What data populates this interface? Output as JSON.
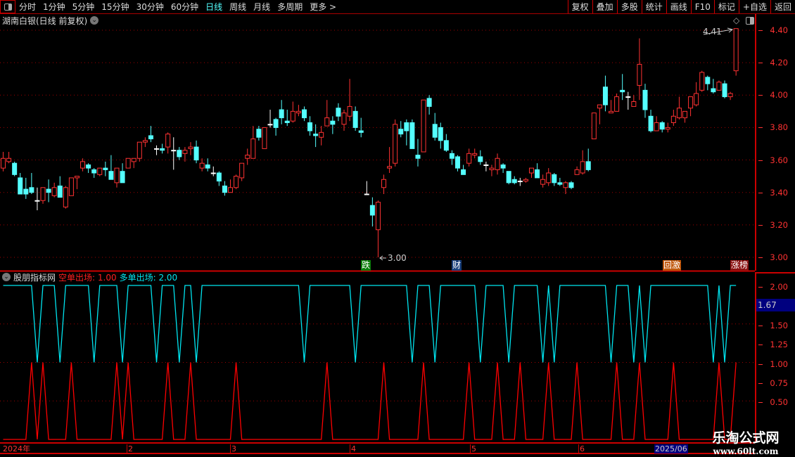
{
  "toolbar": {
    "periods": [
      "分时",
      "1分钟",
      "5分钟",
      "15分钟",
      "30分钟",
      "60分钟",
      "日线",
      "周线",
      "月线",
      "多周期",
      "更多 >"
    ],
    "active_period": "日线",
    "buttons": [
      "复权",
      "叠加",
      "多股",
      "统计",
      "画线",
      "F10",
      "标记",
      "+自选",
      "返回"
    ]
  },
  "title": "湖南白银(日线 前复权)",
  "indicator": {
    "name": "股朋指标网",
    "short_exit_label": "空单出场: 1.00",
    "long_exit_label": "多单出场: 2.00"
  },
  "price_axis": [
    "4.40",
    "4.20",
    "4.00",
    "3.80",
    "3.60",
    "3.40",
    "3.20",
    "3.00"
  ],
  "indicator_axis": [
    "2.00",
    "1.50",
    "1.25",
    "1.00",
    "0.75",
    "0.50"
  ],
  "indicator_cursor_value": "1.67",
  "annotations": {
    "high": "4.41",
    "low": "3.00"
  },
  "event_tags": [
    {
      "text": "跌",
      "color": "#0a7d0a"
    },
    {
      "text": "财",
      "color": "#1a3f7a"
    },
    {
      "text": "回激",
      "color": "#c0560a"
    },
    {
      "text": "涨榜",
      "color": "#8a1010"
    }
  ],
  "date_axis": [
    "2024年",
    "2",
    "3",
    "4",
    "5",
    "6"
  ],
  "date_cursor": "2025/06",
  "logo": {
    "line1": "乐淘公式网",
    "line2": "www.60lt.com"
  },
  "colors": {
    "up": "#ff3232",
    "down": "#54ffff",
    "doji": "#ffffff",
    "grid": "#a00000",
    "short_exit": "#ff0000",
    "long_exit": "#00e5f0"
  },
  "chart_data": [
    {
      "type": "candlestick",
      "ylim": [
        3.0,
        4.4
      ],
      "ohlc": [
        [
          3.55,
          3.65,
          3.53,
          3.61
        ],
        [
          3.59,
          3.65,
          3.58,
          3.61
        ],
        [
          3.58,
          3.59,
          3.5,
          3.51
        ],
        [
          3.49,
          3.52,
          3.39,
          3.39
        ],
        [
          3.42,
          3.49,
          3.36,
          3.39
        ],
        [
          3.43,
          3.52,
          3.39,
          3.4
        ],
        [
          3.35,
          3.43,
          3.29,
          3.35
        ],
        [
          3.35,
          3.43,
          3.33,
          3.43
        ],
        [
          3.42,
          3.48,
          3.34,
          3.4
        ],
        [
          3.38,
          3.46,
          3.37,
          3.43
        ],
        [
          3.44,
          3.5,
          3.37,
          3.37
        ],
        [
          3.31,
          3.44,
          3.3,
          3.43
        ],
        [
          3.38,
          3.49,
          3.38,
          3.49
        ],
        [
          3.49,
          3.5,
          3.42,
          3.5
        ],
        [
          3.55,
          3.61,
          3.53,
          3.59
        ],
        [
          3.57,
          3.58,
          3.52,
          3.55
        ],
        [
          3.54,
          3.55,
          3.49,
          3.52
        ],
        [
          3.51,
          3.55,
          3.5,
          3.55
        ],
        [
          3.55,
          3.59,
          3.5,
          3.54
        ],
        [
          3.53,
          3.63,
          3.48,
          3.48
        ],
        [
          3.46,
          3.55,
          3.43,
          3.55
        ],
        [
          3.53,
          3.58,
          3.46,
          3.46
        ],
        [
          3.55,
          3.61,
          3.55,
          3.61
        ],
        [
          3.59,
          3.61,
          3.55,
          3.61
        ],
        [
          3.61,
          3.71,
          3.59,
          3.71
        ],
        [
          3.71,
          3.74,
          3.68,
          3.72
        ],
        [
          3.75,
          3.81,
          3.71,
          3.73
        ],
        [
          3.67,
          3.69,
          3.63,
          3.67
        ],
        [
          3.67,
          3.7,
          3.64,
          3.66
        ],
        [
          3.68,
          3.77,
          3.64,
          3.76
        ],
        [
          3.66,
          3.74,
          3.54,
          3.66
        ],
        [
          3.66,
          3.68,
          3.6,
          3.62
        ],
        [
          3.64,
          3.68,
          3.59,
          3.66
        ],
        [
          3.67,
          3.71,
          3.63,
          3.68
        ],
        [
          3.68,
          3.72,
          3.58,
          3.6
        ],
        [
          3.55,
          3.61,
          3.53,
          3.58
        ],
        [
          3.57,
          3.61,
          3.53,
          3.55
        ],
        [
          3.52,
          3.56,
          3.5,
          3.52
        ],
        [
          3.52,
          3.53,
          3.44,
          3.47
        ],
        [
          3.44,
          3.47,
          3.38,
          3.4
        ],
        [
          3.4,
          3.48,
          3.4,
          3.43
        ],
        [
          3.43,
          3.51,
          3.42,
          3.5
        ],
        [
          3.49,
          3.58,
          3.47,
          3.58
        ],
        [
          3.61,
          3.67,
          3.57,
          3.63
        ],
        [
          3.61,
          3.81,
          3.61,
          3.73
        ],
        [
          3.79,
          3.81,
          3.72,
          3.74
        ],
        [
          3.67,
          3.8,
          3.67,
          3.8
        ],
        [
          3.82,
          3.91,
          3.8,
          3.82
        ],
        [
          3.85,
          3.86,
          3.75,
          3.8
        ],
        [
          3.91,
          3.97,
          3.82,
          3.86
        ],
        [
          3.84,
          3.91,
          3.81,
          3.83
        ],
        [
          3.84,
          3.96,
          3.83,
          3.9
        ],
        [
          3.89,
          3.94,
          3.87,
          3.9
        ],
        [
          3.91,
          3.93,
          3.84,
          3.86
        ],
        [
          3.83,
          3.87,
          3.75,
          3.78
        ],
        [
          3.76,
          3.82,
          3.68,
          3.75
        ],
        [
          3.74,
          3.81,
          3.69,
          3.77
        ],
        [
          3.81,
          3.97,
          3.81,
          3.86
        ],
        [
          3.84,
          3.87,
          3.76,
          3.82
        ],
        [
          3.92,
          3.95,
          3.84,
          3.87
        ],
        [
          3.82,
          3.91,
          3.78,
          3.89
        ],
        [
          3.87,
          4.1,
          3.84,
          3.93
        ],
        [
          3.9,
          3.93,
          3.78,
          3.8
        ],
        [
          3.78,
          3.86,
          3.74,
          3.77
        ],
        [
          3.39,
          3.47,
          3.39,
          3.39
        ],
        [
          3.32,
          3.37,
          3.19,
          3.26
        ],
        [
          3.17,
          3.35,
          3.0,
          3.34
        ],
        [
          3.43,
          3.51,
          3.39,
          3.48
        ],
        [
          3.55,
          3.68,
          3.52,
          3.56
        ],
        [
          3.58,
          3.85,
          3.56,
          3.82
        ],
        [
          3.79,
          3.84,
          3.74,
          3.76
        ],
        [
          3.83,
          3.85,
          3.69,
          3.78
        ],
        [
          3.83,
          3.85,
          3.67,
          3.67
        ],
        [
          3.63,
          3.73,
          3.56,
          3.61
        ],
        [
          3.65,
          3.97,
          3.65,
          3.97
        ],
        [
          3.98,
          4.0,
          3.88,
          3.93
        ],
        [
          3.82,
          3.89,
          3.72,
          3.74
        ],
        [
          3.8,
          3.83,
          3.67,
          3.72
        ],
        [
          3.72,
          3.76,
          3.65,
          3.66
        ],
        [
          3.64,
          3.66,
          3.57,
          3.61
        ],
        [
          3.62,
          3.63,
          3.53,
          3.55
        ],
        [
          3.54,
          3.57,
          3.51,
          3.51
        ],
        [
          3.58,
          3.67,
          3.56,
          3.64
        ],
        [
          3.63,
          3.67,
          3.61,
          3.64
        ],
        [
          3.62,
          3.66,
          3.57,
          3.59
        ],
        [
          3.57,
          3.59,
          3.53,
          3.57
        ],
        [
          3.54,
          3.57,
          3.5,
          3.55
        ],
        [
          3.54,
          3.64,
          3.51,
          3.61
        ],
        [
          3.57,
          3.58,
          3.52,
          3.55
        ],
        [
          3.53,
          3.53,
          3.45,
          3.46
        ],
        [
          3.48,
          3.5,
          3.45,
          3.46
        ],
        [
          3.47,
          3.49,
          3.44,
          3.47
        ],
        [
          3.47,
          3.49,
          3.46,
          3.48
        ],
        [
          3.52,
          3.55,
          3.49,
          3.55
        ],
        [
          3.54,
          3.58,
          3.49,
          3.49
        ],
        [
          3.45,
          3.51,
          3.43,
          3.48
        ],
        [
          3.46,
          3.55,
          3.44,
          3.52
        ],
        [
          3.51,
          3.52,
          3.44,
          3.46
        ],
        [
          3.46,
          3.49,
          3.44,
          3.45
        ],
        [
          3.43,
          3.47,
          3.39,
          3.46
        ],
        [
          3.46,
          3.47,
          3.42,
          3.43
        ],
        [
          3.51,
          3.56,
          3.51,
          3.54
        ],
        [
          3.52,
          3.66,
          3.51,
          3.59
        ],
        [
          3.59,
          3.67,
          3.53,
          3.54
        ],
        [
          3.73,
          3.89,
          3.73,
          3.89
        ],
        [
          3.92,
          3.94,
          3.82,
          3.94
        ],
        [
          4.05,
          4.12,
          3.9,
          3.94
        ],
        [
          3.89,
          3.97,
          3.89,
          3.9
        ],
        [
          3.9,
          4.01,
          3.9,
          3.99
        ],
        [
          4.03,
          4.13,
          3.97,
          4.02
        ],
        [
          3.99,
          4.02,
          3.91,
          3.99
        ],
        [
          3.93,
          4.0,
          3.93,
          3.96
        ],
        [
          4.06,
          4.35,
          3.97,
          4.19
        ],
        [
          4.03,
          4.07,
          3.86,
          3.91
        ],
        [
          3.87,
          3.91,
          3.77,
          3.78
        ],
        [
          3.78,
          3.87,
          3.78,
          3.83
        ],
        [
          3.83,
          3.84,
          3.77,
          3.79
        ],
        [
          3.79,
          3.83,
          3.77,
          3.8
        ],
        [
          3.83,
          3.91,
          3.81,
          3.87
        ],
        [
          3.86,
          3.99,
          3.85,
          3.92
        ],
        [
          3.86,
          3.9,
          3.83,
          3.9
        ],
        [
          3.92,
          3.99,
          3.87,
          3.99
        ],
        [
          3.94,
          4.08,
          3.93,
          4.01
        ],
        [
          4.03,
          4.15,
          4.02,
          4.14
        ],
        [
          4.11,
          4.12,
          4.03,
          4.07
        ],
        [
          4.04,
          4.1,
          4.01,
          4.02
        ],
        [
          4.03,
          4.09,
          4.03,
          4.08
        ],
        [
          4.07,
          4.09,
          3.98,
          3.99
        ],
        [
          3.99,
          4.02,
          3.97,
          4.01
        ],
        [
          4.15,
          4.41,
          4.12,
          4.41
        ]
      ]
    },
    {
      "type": "line",
      "ylim": [
        0,
        2
      ],
      "series": [
        {
          "name": "空单出场",
          "values": [
            0,
            0,
            0,
            0,
            0,
            1,
            0,
            1,
            0,
            0,
            0,
            0,
            1,
            0,
            0,
            0,
            0,
            0,
            0,
            0,
            1,
            0,
            1,
            0,
            0,
            0,
            0,
            0,
            0,
            1,
            0,
            0,
            0,
            1,
            0,
            0,
            0,
            0,
            0,
            0,
            0,
            1,
            0,
            0,
            0,
            0,
            0,
            0,
            0,
            0,
            0,
            0,
            0,
            0,
            0,
            0,
            0,
            1,
            0,
            0,
            0,
            0,
            0,
            0,
            0,
            0,
            0,
            1,
            0,
            0,
            0,
            0,
            0,
            0,
            1,
            0,
            0,
            0,
            0,
            0,
            0,
            0,
            1,
            0,
            0,
            0,
            0,
            1,
            0,
            0,
            0,
            1,
            0,
            0,
            0,
            0,
            1,
            0,
            0,
            0,
            0,
            1,
            0,
            0,
            0,
            0,
            0,
            0,
            1,
            0,
            0,
            0,
            1,
            0,
            0,
            0,
            0,
            0,
            1,
            0,
            0,
            0,
            0,
            0,
            0,
            0,
            1,
            0,
            0,
            1
          ]
        },
        {
          "name": "多单出场",
          "values": [
            2,
            2,
            2,
            2,
            2,
            2,
            1,
            2,
            2,
            2,
            1,
            2,
            2,
            2,
            2,
            2,
            1,
            2,
            2,
            2,
            2,
            1,
            2,
            2,
            2,
            2,
            2,
            1,
            2,
            2,
            2,
            1,
            2,
            2,
            1,
            2,
            2,
            2,
            2,
            2,
            2,
            2,
            2,
            2,
            2,
            2,
            2,
            2,
            2,
            2,
            2,
            2,
            2,
            1,
            2,
            2,
            2,
            2,
            2,
            2,
            2,
            2,
            1,
            2,
            2,
            2,
            2,
            2,
            2,
            2,
            2,
            2,
            1,
            2,
            2,
            2,
            1,
            2,
            2,
            2,
            2,
            2,
            2,
            2,
            1,
            2,
            2,
            2,
            2,
            1,
            2,
            2,
            2,
            2,
            2,
            1,
            2,
            1,
            2,
            2,
            2,
            2,
            2,
            2,
            2,
            2,
            2,
            1,
            2,
            2,
            2,
            1,
            2,
            1,
            2,
            2,
            2,
            2,
            2,
            2,
            2,
            2,
            2,
            2,
            2,
            1,
            2,
            1,
            2,
            2
          ]
        }
      ]
    }
  ]
}
